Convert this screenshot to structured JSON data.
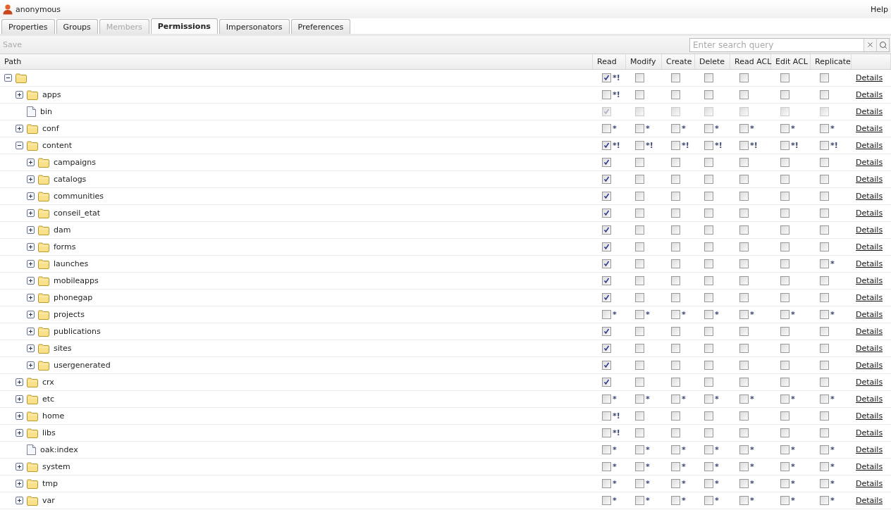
{
  "user": {
    "name": "anonymous"
  },
  "help": "Help",
  "tabs": [
    {
      "label": "Properties",
      "selected": false,
      "disabled": false
    },
    {
      "label": "Groups",
      "selected": false,
      "disabled": false
    },
    {
      "label": "Members",
      "selected": false,
      "disabled": true
    },
    {
      "label": "Permissions",
      "selected": true,
      "disabled": false
    },
    {
      "label": "Impersonators",
      "selected": false,
      "disabled": false
    },
    {
      "label": "Preferences",
      "selected": false,
      "disabled": false
    }
  ],
  "toolbar": {
    "save": {
      "label": "Save",
      "disabled": true
    },
    "search": {
      "placeholder": "Enter search query"
    }
  },
  "columns": [
    "Path",
    "Read",
    "Modify",
    "Create",
    "Delete",
    "Read ACL",
    "Edit ACL",
    "Replicate"
  ],
  "tree": {
    "kind": "folder",
    "expanded": true,
    "details": "Details",
    "perms": [
      {
        "checked": true,
        "note": "*!"
      },
      {
        "checked": false
      },
      {
        "checked": false
      },
      {
        "checked": false
      },
      {
        "checked": false
      },
      {
        "checked": false
      },
      {
        "checked": false
      }
    ],
    "children": [
      {
        "name": "apps",
        "kind": "folder",
        "expanded": false,
        "details": "Details",
        "perms": [
          {
            "checked": false,
            "note": "*!"
          },
          {
            "checked": false
          },
          {
            "checked": false
          },
          {
            "checked": false
          },
          {
            "checked": false
          },
          {
            "checked": false
          },
          {
            "checked": false
          }
        ]
      },
      {
        "name": "bin",
        "kind": "file",
        "disabled": true,
        "details": "Details",
        "perms": [
          {
            "checked": true
          },
          {
            "checked": false
          },
          {
            "checked": false
          },
          {
            "checked": false
          },
          {
            "checked": false
          },
          {
            "checked": false
          },
          {
            "checked": false
          }
        ]
      },
      {
        "name": "conf",
        "kind": "folder",
        "expanded": false,
        "details": "Details",
        "perms": [
          {
            "checked": false,
            "note": "*"
          },
          {
            "checked": false,
            "note": "*"
          },
          {
            "checked": false,
            "note": "*"
          },
          {
            "checked": false,
            "note": "*"
          },
          {
            "checked": false,
            "note": "*"
          },
          {
            "checked": false,
            "note": "*"
          },
          {
            "checked": false,
            "note": "*"
          }
        ]
      },
      {
        "name": "content",
        "kind": "folder",
        "expanded": true,
        "details": "Details",
        "perms": [
          {
            "checked": true,
            "note": "*!"
          },
          {
            "checked": false,
            "note": "*!"
          },
          {
            "checked": false,
            "note": "*!"
          },
          {
            "checked": false,
            "note": "*!"
          },
          {
            "checked": false,
            "note": "*!"
          },
          {
            "checked": false,
            "note": "*!"
          },
          {
            "checked": false,
            "note": "*!"
          }
        ],
        "children": [
          {
            "name": "campaigns",
            "kind": "folder",
            "expanded": false,
            "details": "Details",
            "perms": [
              {
                "checked": true
              },
              {
                "checked": false
              },
              {
                "checked": false
              },
              {
                "checked": false
              },
              {
                "checked": false
              },
              {
                "checked": false
              },
              {
                "checked": false
              }
            ]
          },
          {
            "name": "catalogs",
            "kind": "folder",
            "expanded": false,
            "details": "Details",
            "perms": [
              {
                "checked": true
              },
              {
                "checked": false
              },
              {
                "checked": false
              },
              {
                "checked": false
              },
              {
                "checked": false
              },
              {
                "checked": false
              },
              {
                "checked": false
              }
            ]
          },
          {
            "name": "communities",
            "kind": "folder",
            "expanded": false,
            "details": "Details",
            "perms": [
              {
                "checked": true
              },
              {
                "checked": false
              },
              {
                "checked": false
              },
              {
                "checked": false
              },
              {
                "checked": false
              },
              {
                "checked": false
              },
              {
                "checked": false
              }
            ]
          },
          {
            "name": "conseil_etat",
            "kind": "folder",
            "expanded": false,
            "details": "Details",
            "perms": [
              {
                "checked": true
              },
              {
                "checked": false
              },
              {
                "checked": false
              },
              {
                "checked": false
              },
              {
                "checked": false
              },
              {
                "checked": false
              },
              {
                "checked": false
              }
            ]
          },
          {
            "name": "dam",
            "kind": "folder",
            "expanded": false,
            "details": "Details",
            "perms": [
              {
                "checked": true
              },
              {
                "checked": false
              },
              {
                "checked": false
              },
              {
                "checked": false
              },
              {
                "checked": false
              },
              {
                "checked": false
              },
              {
                "checked": false
              }
            ]
          },
          {
            "name": "forms",
            "kind": "folder",
            "expanded": false,
            "details": "Details",
            "perms": [
              {
                "checked": true
              },
              {
                "checked": false
              },
              {
                "checked": false
              },
              {
                "checked": false
              },
              {
                "checked": false
              },
              {
                "checked": false
              },
              {
                "checked": false
              }
            ]
          },
          {
            "name": "launches",
            "kind": "folder",
            "expanded": false,
            "details": "Details",
            "perms": [
              {
                "checked": true
              },
              {
                "checked": false
              },
              {
                "checked": false
              },
              {
                "checked": false
              },
              {
                "checked": false
              },
              {
                "checked": false
              },
              {
                "checked": false,
                "note": "*"
              }
            ]
          },
          {
            "name": "mobileapps",
            "kind": "folder",
            "expanded": false,
            "details": "Details",
            "perms": [
              {
                "checked": true
              },
              {
                "checked": false
              },
              {
                "checked": false
              },
              {
                "checked": false
              },
              {
                "checked": false
              },
              {
                "checked": false
              },
              {
                "checked": false
              }
            ]
          },
          {
            "name": "phonegap",
            "kind": "folder",
            "expanded": false,
            "details": "Details",
            "perms": [
              {
                "checked": true
              },
              {
                "checked": false
              },
              {
                "checked": false
              },
              {
                "checked": false
              },
              {
                "checked": false
              },
              {
                "checked": false
              },
              {
                "checked": false
              }
            ]
          },
          {
            "name": "projects",
            "kind": "folder",
            "expanded": false,
            "details": "Details",
            "perms": [
              {
                "checked": false,
                "note": "*"
              },
              {
                "checked": false,
                "note": "*"
              },
              {
                "checked": false,
                "note": "*"
              },
              {
                "checked": false,
                "note": "*"
              },
              {
                "checked": false,
                "note": "*"
              },
              {
                "checked": false,
                "note": "*"
              },
              {
                "checked": false,
                "note": "*"
              }
            ]
          },
          {
            "name": "publications",
            "kind": "folder",
            "expanded": false,
            "details": "Details",
            "perms": [
              {
                "checked": true
              },
              {
                "checked": false
              },
              {
                "checked": false
              },
              {
                "checked": false
              },
              {
                "checked": false
              },
              {
                "checked": false
              },
              {
                "checked": false
              }
            ]
          },
          {
            "name": "sites",
            "kind": "folder",
            "expanded": false,
            "details": "Details",
            "perms": [
              {
                "checked": true
              },
              {
                "checked": false
              },
              {
                "checked": false
              },
              {
                "checked": false
              },
              {
                "checked": false
              },
              {
                "checked": false
              },
              {
                "checked": false
              }
            ]
          },
          {
            "name": "usergenerated",
            "kind": "folder",
            "expanded": false,
            "details": "Details",
            "perms": [
              {
                "checked": true
              },
              {
                "checked": false
              },
              {
                "checked": false
              },
              {
                "checked": false
              },
              {
                "checked": false
              },
              {
                "checked": false
              },
              {
                "checked": false
              }
            ]
          }
        ]
      },
      {
        "name": "crx",
        "kind": "folder",
        "expanded": false,
        "details": "Details",
        "perms": [
          {
            "checked": true
          },
          {
            "checked": false
          },
          {
            "checked": false
          },
          {
            "checked": false
          },
          {
            "checked": false
          },
          {
            "checked": false
          },
          {
            "checked": false
          }
        ]
      },
      {
        "name": "etc",
        "kind": "folder",
        "expanded": false,
        "details": "Details",
        "perms": [
          {
            "checked": false,
            "note": "*"
          },
          {
            "checked": false,
            "note": "*"
          },
          {
            "checked": false,
            "note": "*"
          },
          {
            "checked": false,
            "note": "*"
          },
          {
            "checked": false,
            "note": "*"
          },
          {
            "checked": false,
            "note": "*"
          },
          {
            "checked": false,
            "note": "*"
          }
        ]
      },
      {
        "name": "home",
        "kind": "folder",
        "expanded": false,
        "details": "Details",
        "perms": [
          {
            "checked": false,
            "note": "*!"
          },
          {
            "checked": false
          },
          {
            "checked": false
          },
          {
            "checked": false
          },
          {
            "checked": false
          },
          {
            "checked": false
          },
          {
            "checked": false
          }
        ]
      },
      {
        "name": "libs",
        "kind": "folder",
        "expanded": false,
        "details": "Details",
        "perms": [
          {
            "checked": false,
            "note": "*!"
          },
          {
            "checked": false
          },
          {
            "checked": false
          },
          {
            "checked": false
          },
          {
            "checked": false
          },
          {
            "checked": false
          },
          {
            "checked": false
          }
        ]
      },
      {
        "name": "oak:index",
        "kind": "file",
        "details": "Details",
        "perms": [
          {
            "checked": false,
            "note": "*"
          },
          {
            "checked": false,
            "note": "*"
          },
          {
            "checked": false,
            "note": "*"
          },
          {
            "checked": false,
            "note": "*"
          },
          {
            "checked": false,
            "note": "*"
          },
          {
            "checked": false,
            "note": "*"
          },
          {
            "checked": false,
            "note": "*"
          }
        ]
      },
      {
        "name": "system",
        "kind": "folder",
        "expanded": false,
        "details": "Details",
        "perms": [
          {
            "checked": false,
            "note": "*"
          },
          {
            "checked": false,
            "note": "*"
          },
          {
            "checked": false,
            "note": "*"
          },
          {
            "checked": false,
            "note": "*"
          },
          {
            "checked": false,
            "note": "*"
          },
          {
            "checked": false,
            "note": "*"
          },
          {
            "checked": false,
            "note": "*"
          }
        ]
      },
      {
        "name": "tmp",
        "kind": "folder",
        "expanded": false,
        "details": "Details",
        "perms": [
          {
            "checked": false,
            "note": "*"
          },
          {
            "checked": false,
            "note": "*"
          },
          {
            "checked": false,
            "note": "*"
          },
          {
            "checked": false,
            "note": "*"
          },
          {
            "checked": false,
            "note": "*"
          },
          {
            "checked": false,
            "note": "*"
          },
          {
            "checked": false,
            "note": "*"
          }
        ]
      },
      {
        "name": "var",
        "kind": "folder",
        "expanded": false,
        "details": "Details",
        "perms": [
          {
            "checked": false,
            "note": "*"
          },
          {
            "checked": false,
            "note": "*"
          },
          {
            "checked": false,
            "note": "*"
          },
          {
            "checked": false,
            "note": "*"
          },
          {
            "checked": false,
            "note": "*"
          },
          {
            "checked": false,
            "note": "*"
          },
          {
            "checked": false,
            "note": "*"
          }
        ]
      }
    ]
  }
}
